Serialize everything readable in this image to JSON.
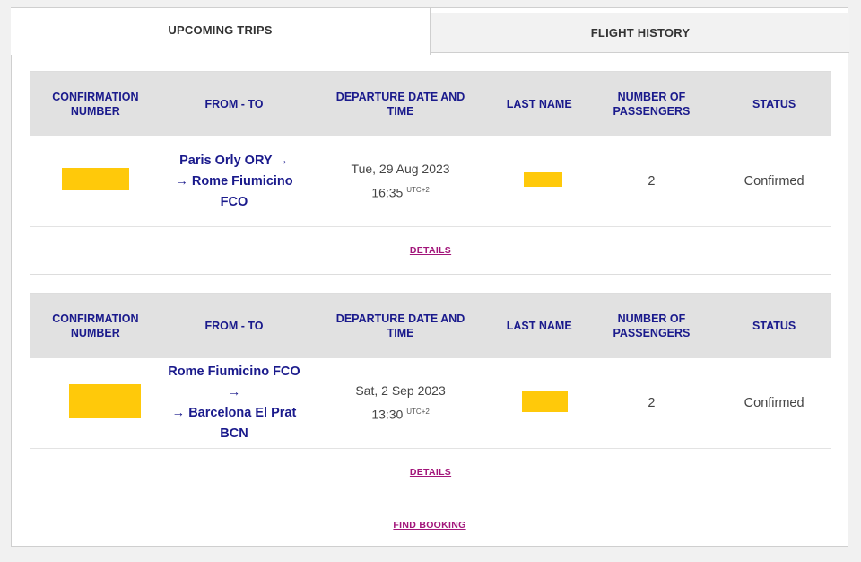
{
  "tabs": {
    "upcoming": "UPCOMING TRIPS",
    "history": "FLIGHT HISTORY"
  },
  "headers": {
    "confirmation": [
      "CONFIRMATION",
      "NUMBER"
    ],
    "route": "FROM - TO",
    "departure": [
      "DEPARTURE DATE AND",
      "TIME"
    ],
    "last_name": "LAST NAME",
    "passengers": [
      "NUMBER OF",
      "PASSENGERS"
    ],
    "status": "STATUS"
  },
  "trips": [
    {
      "from": "Paris Orly ORY",
      "to": "Rome Fiumicino FCO",
      "date": "Tue, 29 Aug 2023",
      "time": "16:35",
      "tz": "UTC+2",
      "passengers": "2",
      "status": "Confirmed",
      "details": "DETAILS"
    },
    {
      "from": "Rome Fiumicino FCO",
      "to": "Barcelona El Prat BCN",
      "date": "Sat, 2 Sep 2023",
      "time": "13:30",
      "tz": "UTC+2",
      "passengers": "2",
      "status": "Confirmed",
      "details": "DETAILS"
    }
  ],
  "arrow": "→",
  "find_booking": "FIND BOOKING",
  "colors": {
    "accent": "#1a1a8c",
    "link": "#a2157a",
    "redaction": "#ffc90a",
    "header_bg": "#e1e1e1"
  }
}
